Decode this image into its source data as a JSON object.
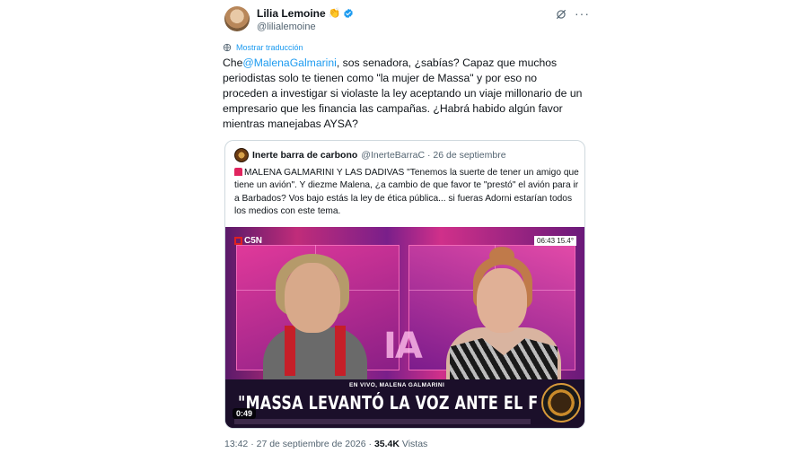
{
  "author": {
    "name": "Lilia Lemoine",
    "name_emoji": "👏",
    "handle": "@lilialemoine",
    "verified": true
  },
  "icons": {
    "verified": "verified-badge-icon",
    "grok": "grok-icon",
    "more": "more-icon",
    "globe": "globe-icon"
  },
  "translate_label": "Mostrar traducción",
  "tweet": {
    "mention": "@MalenaGalmarini",
    "text_prefix": "Che",
    "text_rest": ", sos senadora, ¿sabías? Capaz que muchos periodistas solo te tienen como \"la mujer de Massa\" y por eso no proceden a investigar si violaste la ley aceptando un viaje millonario de un empresario que les financia las campañas. ¿Habrá habido algún favor mientras manejabas AYSA?"
  },
  "quote": {
    "author_name": "Inerte barra de carbono",
    "handle_date": "@InerteBarraC · 26 de septiembre",
    "text": "MALENA GALMARINI Y LAS DADIVAS \"Tenemos la suerte de tener un amigo que tiene un avión\". Y diezme Malena, ¿a cambio de que favor te \"prestó\" el avión para ir a Barbados? Vos bajo estás la ley de ética pública... si fueras Adorni estarían todos los medios con este tema.",
    "video": {
      "channel": "C5N",
      "clock": "06:43 15.4°",
      "live_label": "EN VIVO, MALENA GALMARINI",
      "headline": "\"MASSA LEVANTÓ LA VOZ ANTE EL F",
      "duration": "0:49",
      "studio_logo": "IA"
    }
  },
  "meta": {
    "time_date": "13:42 · 27 de septiembre de 2026 · ",
    "views_count": "35.4K",
    "views_label": " Vistas"
  },
  "colors": {
    "link": "#1d9bf0",
    "secondary_text": "#536471",
    "border": "#cfd9de"
  }
}
